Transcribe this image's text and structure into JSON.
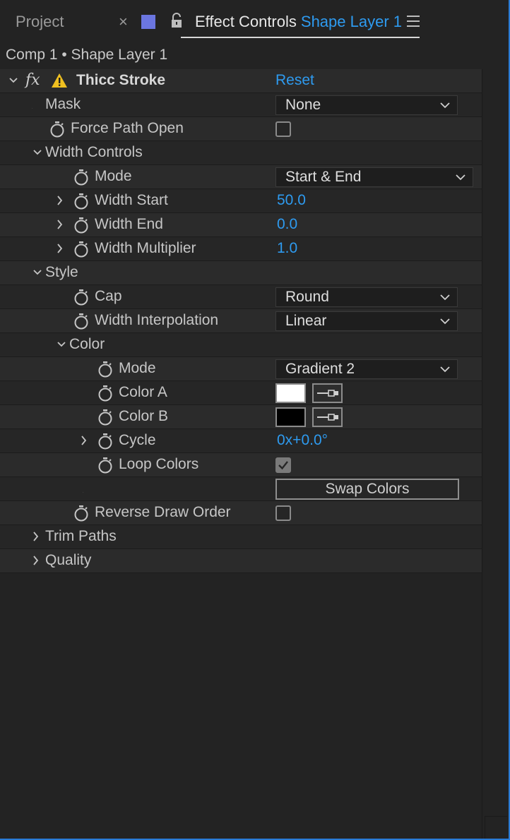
{
  "tabs": {
    "project_label": "Project",
    "close_glyph": "×",
    "swatch_color": "#6b76e0",
    "effect_controls_label": "Effect Controls",
    "layer_name": "Shape Layer 1"
  },
  "breadcrumb": "Comp 1 • Shape Layer 1",
  "effect": {
    "fx_label": "fx",
    "name": "Thicc Stroke",
    "reset_label": "Reset"
  },
  "props": {
    "mask": {
      "label": "Mask",
      "value": "None"
    },
    "force_path_open": {
      "label": "Force Path Open",
      "checked": false
    },
    "width_controls": {
      "label": "Width Controls"
    },
    "width_mode": {
      "label": "Mode",
      "value": "Start & End"
    },
    "width_start": {
      "label": "Width Start",
      "value": "50.0"
    },
    "width_end": {
      "label": "Width End",
      "value": "0.0"
    },
    "width_multiplier": {
      "label": "Width Multiplier",
      "value": "1.0"
    },
    "style": {
      "label": "Style"
    },
    "cap": {
      "label": "Cap",
      "value": "Round"
    },
    "width_interpolation": {
      "label": "Width Interpolation",
      "value": "Linear"
    },
    "color": {
      "label": "Color"
    },
    "color_mode": {
      "label": "Mode",
      "value": "Gradient 2"
    },
    "color_a": {
      "label": "Color A",
      "color": "#ffffff"
    },
    "color_b": {
      "label": "Color B",
      "color": "#000000"
    },
    "cycle": {
      "label": "Cycle",
      "value": "0x+0.0°"
    },
    "loop_colors": {
      "label": "Loop Colors",
      "checked": true
    },
    "swap_colors": {
      "label": "Swap Colors"
    },
    "reverse_draw_order": {
      "label": "Reverse Draw Order",
      "checked": false
    },
    "trim_paths": {
      "label": "Trim Paths"
    },
    "quality": {
      "label": "Quality"
    }
  }
}
